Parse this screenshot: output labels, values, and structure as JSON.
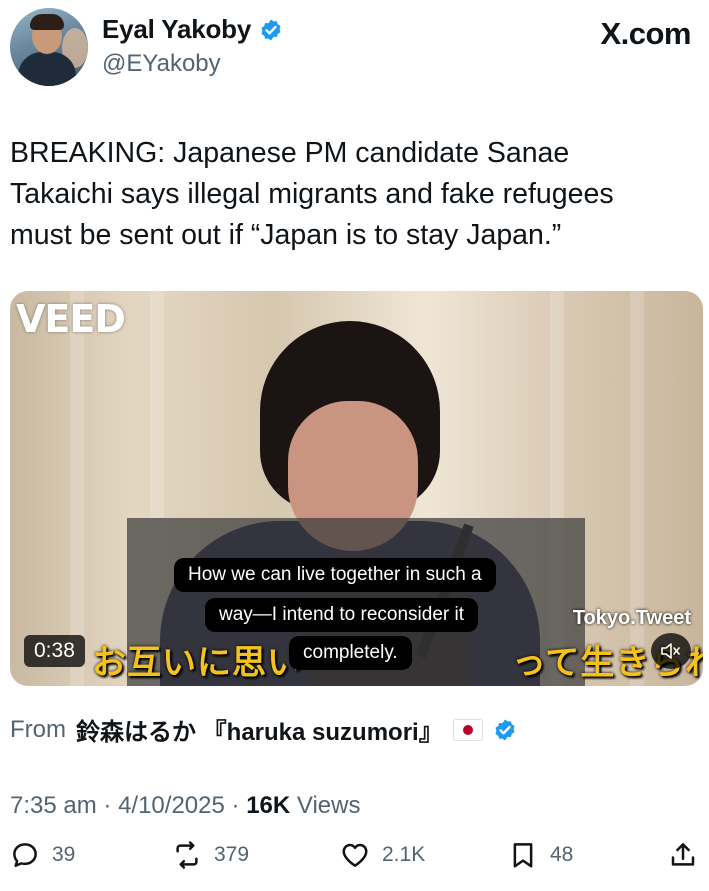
{
  "author": {
    "name": "Eyal Yakoby",
    "handle": "@EYakoby"
  },
  "site_label": "X.com",
  "tweet": {
    "text": "BREAKING: Japanese PM candidate Sanae\nTakaichi says illegal migrants and fake refugees\nmust be sent out if “Japan is to stay Japan.”"
  },
  "video": {
    "watermark": "VEED",
    "caption_lines": [
      "How we can live together in such a",
      "way—I intend to reconsider it",
      "completely."
    ],
    "japanese_subtitle": "お互いに思い　　　　　　って生きられる",
    "channel_tag": "Tokyo.Tweet",
    "timestamp": "0:38"
  },
  "source": {
    "from_label": "From",
    "name": "鈴森はるか 『haruka suzumori』"
  },
  "meta": {
    "time": "7:35 am",
    "date": "4/10/2025",
    "views_count": "16K",
    "views_label": "Views"
  },
  "actions": {
    "replies": "39",
    "reposts": "379",
    "likes": "2.1K",
    "bookmarks": "48"
  },
  "colors": {
    "verified": "#1d9bf0",
    "secondary_text": "#536471",
    "subtitle_yellow": "#f4c21b"
  }
}
